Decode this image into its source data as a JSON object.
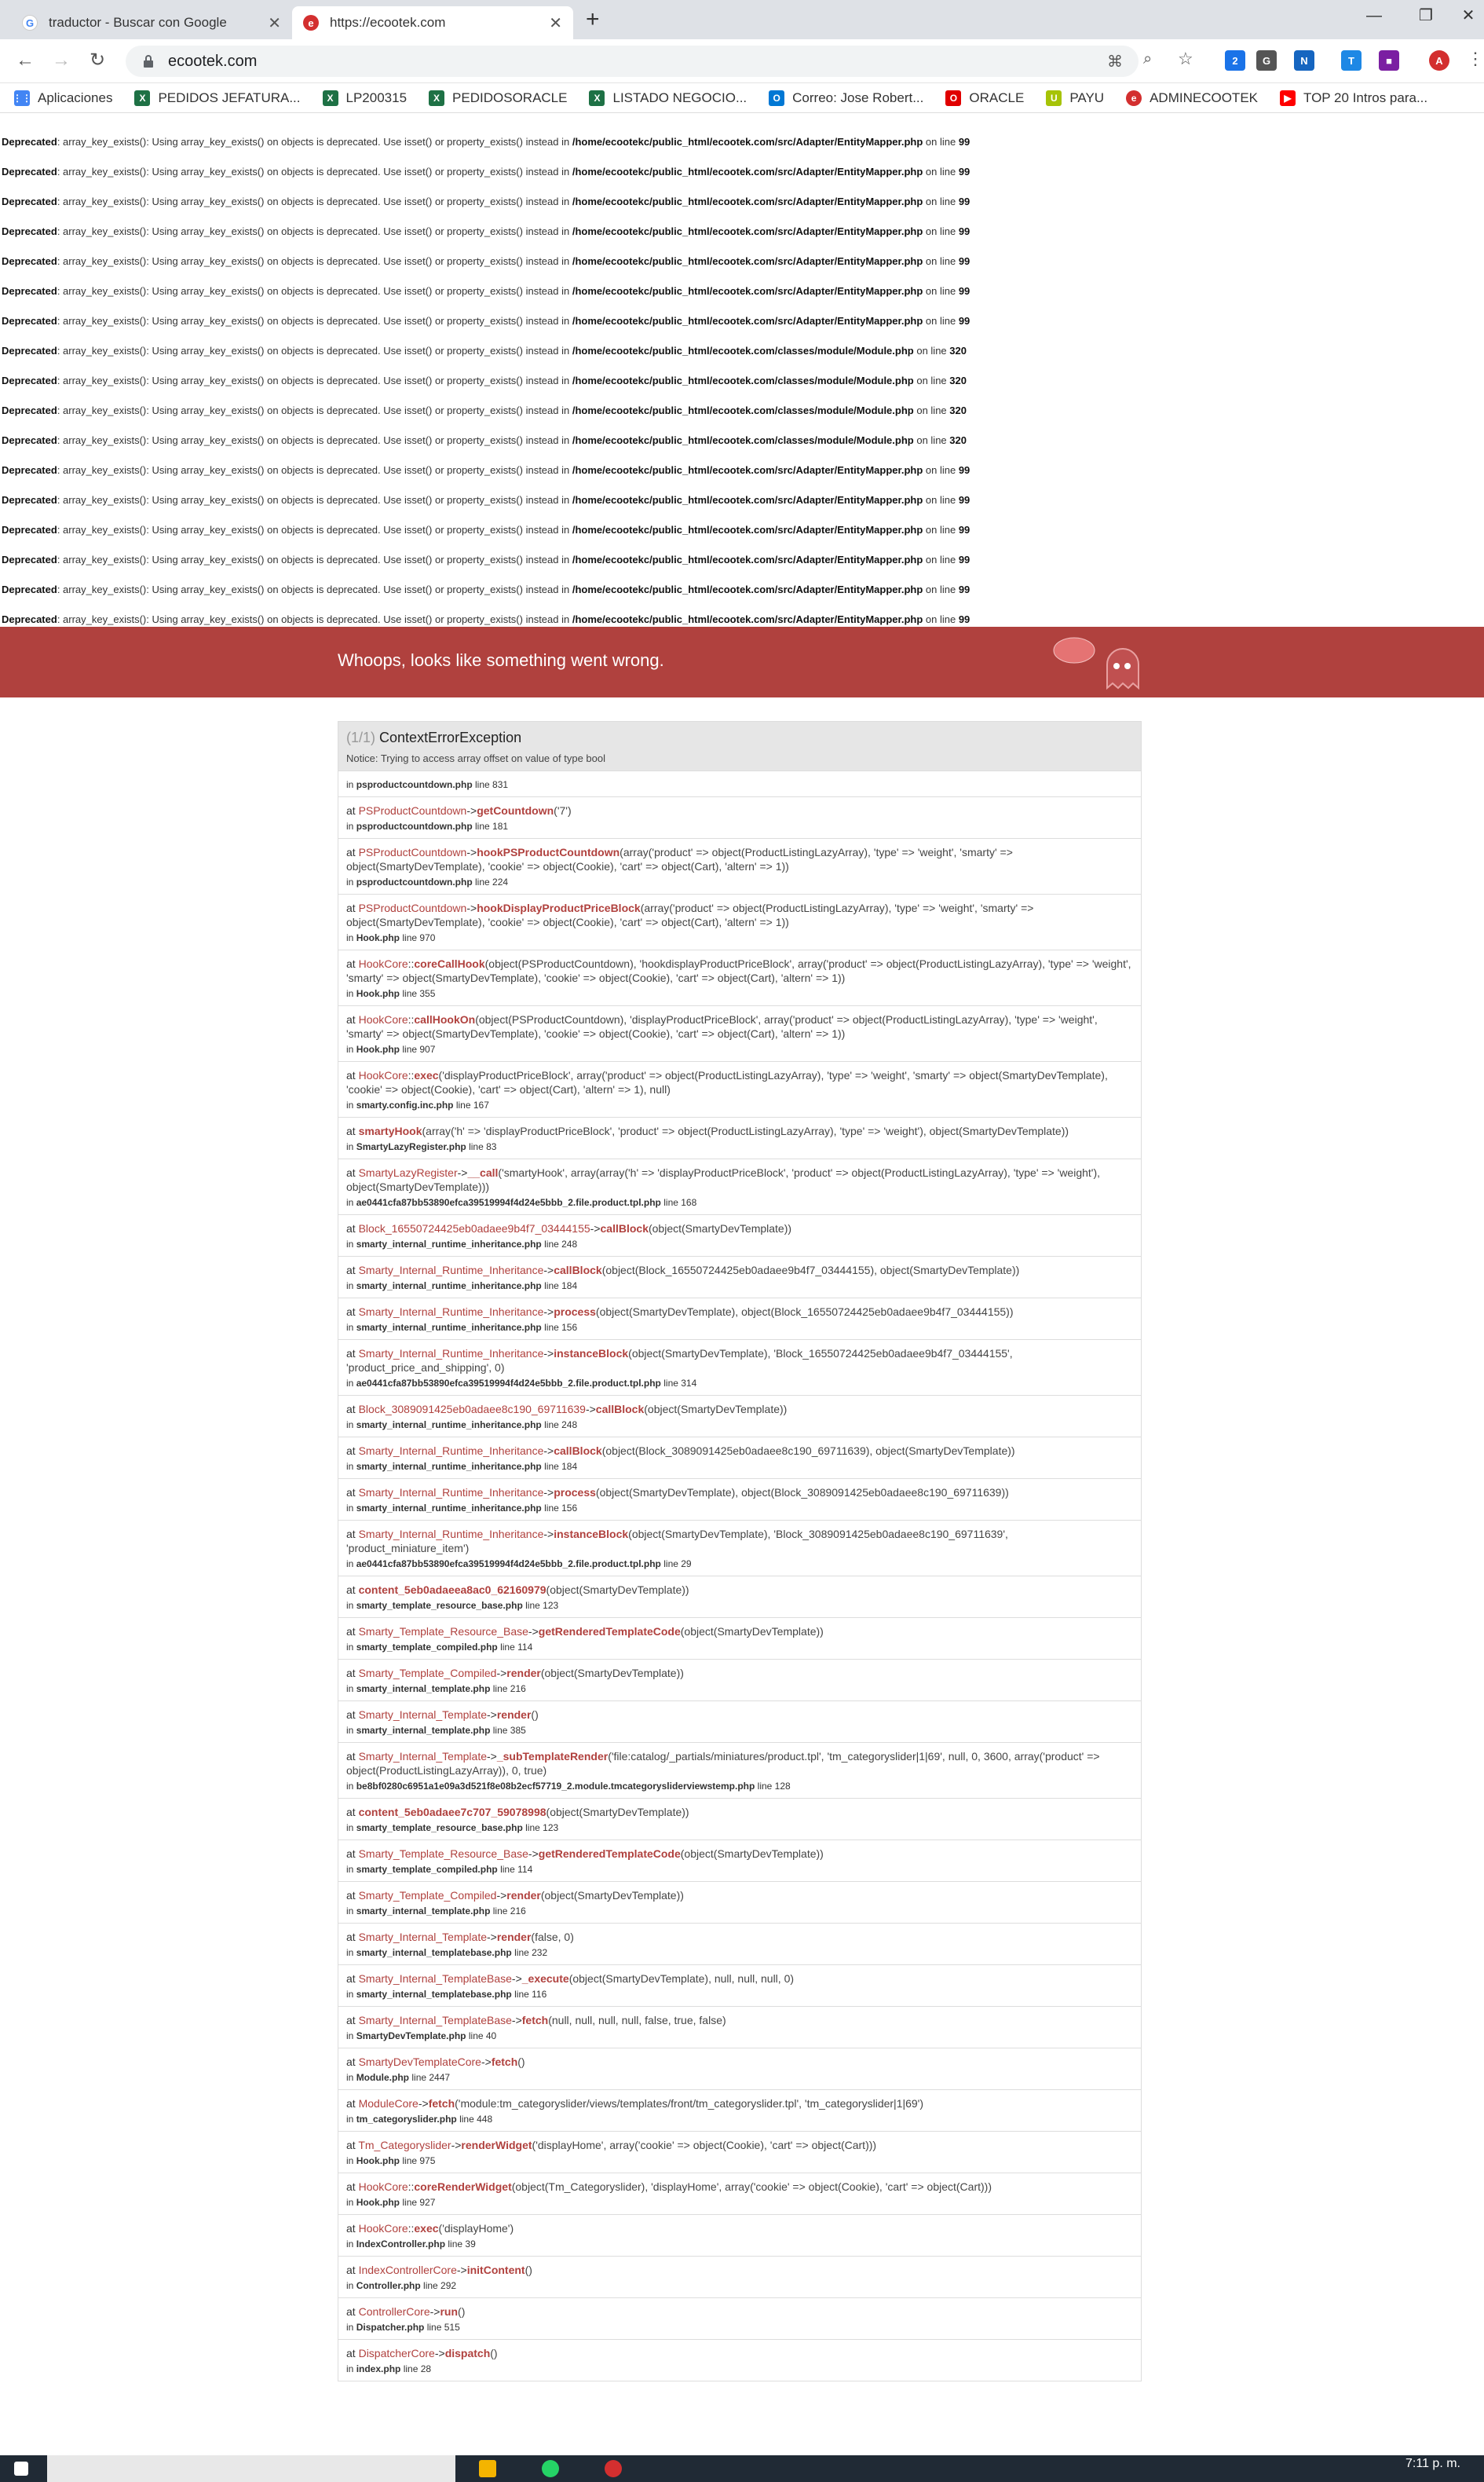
{
  "browser": {
    "tabs": [
      {
        "title": "traductor - Buscar con Google",
        "icon": "google-icon"
      },
      {
        "title": "https://ecootek.com",
        "icon": "ecootek-icon"
      }
    ],
    "new_tab_label": "+",
    "url": "ecootek.com",
    "bookmarks": [
      {
        "label": "Aplicaciones",
        "icon": "apps-grid-icon",
        "color": "#4285f4"
      },
      {
        "label": "PEDIDOS JEFATURA...",
        "icon": "excel-icon",
        "color": "#1e7145"
      },
      {
        "label": "LP200315",
        "icon": "excel-icon",
        "color": "#1e7145"
      },
      {
        "label": "PEDIDOSORACLE",
        "icon": "excel-icon",
        "color": "#1e7145"
      },
      {
        "label": "LISTADO NEGOCIO...",
        "icon": "excel-icon",
        "color": "#1e7145"
      },
      {
        "label": "Correo: Jose Robert...",
        "icon": "outlook-icon",
        "color": "#0078d4"
      },
      {
        "label": "ORACLE",
        "icon": "oracle-icon",
        "color": "#e00000"
      },
      {
        "label": "PAYU",
        "icon": "payu-icon",
        "color": "#a6c307"
      },
      {
        "label": "ADMINECOOTEK",
        "icon": "ecootek-icon",
        "color": "#d32f2f"
      },
      {
        "label": "TOP 20 Intros para...",
        "icon": "youtube-icon",
        "color": "#ff0000"
      }
    ],
    "colors": {
      "tabstrip": "#dee1e6",
      "accent": "#b0413e"
    }
  },
  "deprecated": [
    {
      "label": "Deprecated",
      "msg": ": array_key_exists(): Using array_key_exists() on objects is deprecated. Use isset() or property_exists() instead in ",
      "path": "/home/ecootekc/public_html/ecootek.com/src/Adapter/EntityMapper.php",
      "online": " on line ",
      "line": "99"
    },
    {
      "label": "Deprecated",
      "msg": ": array_key_exists(): Using array_key_exists() on objects is deprecated. Use isset() or property_exists() instead in ",
      "path": "/home/ecootekc/public_html/ecootek.com/src/Adapter/EntityMapper.php",
      "online": " on line ",
      "line": "99"
    },
    {
      "label": "Deprecated",
      "msg": ": array_key_exists(): Using array_key_exists() on objects is deprecated. Use isset() or property_exists() instead in ",
      "path": "/home/ecootekc/public_html/ecootek.com/src/Adapter/EntityMapper.php",
      "online": " on line ",
      "line": "99"
    },
    {
      "label": "Deprecated",
      "msg": ": array_key_exists(): Using array_key_exists() on objects is deprecated. Use isset() or property_exists() instead in ",
      "path": "/home/ecootekc/public_html/ecootek.com/src/Adapter/EntityMapper.php",
      "online": " on line ",
      "line": "99"
    },
    {
      "label": "Deprecated",
      "msg": ": array_key_exists(): Using array_key_exists() on objects is deprecated. Use isset() or property_exists() instead in ",
      "path": "/home/ecootekc/public_html/ecootek.com/src/Adapter/EntityMapper.php",
      "online": " on line ",
      "line": "99"
    },
    {
      "label": "Deprecated",
      "msg": ": array_key_exists(): Using array_key_exists() on objects is deprecated. Use isset() or property_exists() instead in ",
      "path": "/home/ecootekc/public_html/ecootek.com/src/Adapter/EntityMapper.php",
      "online": " on line ",
      "line": "99"
    },
    {
      "label": "Deprecated",
      "msg": ": array_key_exists(): Using array_key_exists() on objects is deprecated. Use isset() or property_exists() instead in ",
      "path": "/home/ecootekc/public_html/ecootek.com/src/Adapter/EntityMapper.php",
      "online": " on line ",
      "line": "99"
    },
    {
      "label": "Deprecated",
      "msg": ": array_key_exists(): Using array_key_exists() on objects is deprecated. Use isset() or property_exists() instead in ",
      "path": "/home/ecootekc/public_html/ecootek.com/classes/module/Module.php",
      "online": " on line ",
      "line": "320"
    },
    {
      "label": "Deprecated",
      "msg": ": array_key_exists(): Using array_key_exists() on objects is deprecated. Use isset() or property_exists() instead in ",
      "path": "/home/ecootekc/public_html/ecootek.com/classes/module/Module.php",
      "online": " on line ",
      "line": "320"
    },
    {
      "label": "Deprecated",
      "msg": ": array_key_exists(): Using array_key_exists() on objects is deprecated. Use isset() or property_exists() instead in ",
      "path": "/home/ecootekc/public_html/ecootek.com/classes/module/Module.php",
      "online": " on line ",
      "line": "320"
    },
    {
      "label": "Deprecated",
      "msg": ": array_key_exists(): Using array_key_exists() on objects is deprecated. Use isset() or property_exists() instead in ",
      "path": "/home/ecootekc/public_html/ecootek.com/classes/module/Module.php",
      "online": " on line ",
      "line": "320"
    },
    {
      "label": "Deprecated",
      "msg": ": array_key_exists(): Using array_key_exists() on objects is deprecated. Use isset() or property_exists() instead in ",
      "path": "/home/ecootekc/public_html/ecootek.com/src/Adapter/EntityMapper.php",
      "online": " on line ",
      "line": "99"
    },
    {
      "label": "Deprecated",
      "msg": ": array_key_exists(): Using array_key_exists() on objects is deprecated. Use isset() or property_exists() instead in ",
      "path": "/home/ecootekc/public_html/ecootek.com/src/Adapter/EntityMapper.php",
      "online": " on line ",
      "line": "99"
    },
    {
      "label": "Deprecated",
      "msg": ": array_key_exists(): Using array_key_exists() on objects is deprecated. Use isset() or property_exists() instead in ",
      "path": "/home/ecootekc/public_html/ecootek.com/src/Adapter/EntityMapper.php",
      "online": " on line ",
      "line": "99"
    },
    {
      "label": "Deprecated",
      "msg": ": array_key_exists(): Using array_key_exists() on objects is deprecated. Use isset() or property_exists() instead in ",
      "path": "/home/ecootekc/public_html/ecootek.com/src/Adapter/EntityMapper.php",
      "online": " on line ",
      "line": "99"
    },
    {
      "label": "Deprecated",
      "msg": ": array_key_exists(): Using array_key_exists() on objects is deprecated. Use isset() or property_exists() instead in ",
      "path": "/home/ecootekc/public_html/ecootek.com/src/Adapter/EntityMapper.php",
      "online": " on line ",
      "line": "99"
    },
    {
      "label": "Deprecated",
      "msg": ": array_key_exists(): Using array_key_exists() on objects is deprecated. Use isset() or property_exists() instead in ",
      "path": "/home/ecootekc/public_html/ecootek.com/src/Adapter/EntityMapper.php",
      "online": " on line ",
      "line": "99"
    },
    {
      "label": "Deprecated",
      "msg": ": array_key_exists(): Using array_key_exists() on objects is deprecated. Use isset() or property_exists() instead in ",
      "path": "/home/ecootekc/public_html/ecootek.com/src/Adapter/EntityMapper.php",
      "online": " on line ",
      "line": "99"
    }
  ],
  "whoops": {
    "message": "Whoops, looks like something went wrong."
  },
  "exception": {
    "count": "(1/1)",
    "name": "ContextErrorException",
    "notice": "Notice: Trying to access array offset on value of type bool",
    "first_in": "in ",
    "first_file": "psproductcountdown.php",
    "first_line": " line 831",
    "frames": [
      {
        "cls": "PSProductCountdown",
        "op": "->",
        "fn": "getCountdown",
        "args": "('7')",
        "file": "psproductcountdown.php",
        "line": "line 181"
      },
      {
        "cls": "PSProductCountdown",
        "op": "->",
        "fn": "hookPSProductCountdown",
        "args": "(array('product' => object(ProductListingLazyArray), 'type' => 'weight', 'smarty' => object(SmartyDevTemplate), 'cookie' => object(Cookie), 'cart' => object(Cart), 'altern' => 1))",
        "file": "psproductcountdown.php",
        "line": "line 224"
      },
      {
        "cls": "PSProductCountdown",
        "op": "->",
        "fn": "hookDisplayProductPriceBlock",
        "args": "(array('product' => object(ProductListingLazyArray), 'type' => 'weight', 'smarty' => object(SmartyDevTemplate), 'cookie' => object(Cookie), 'cart' => object(Cart), 'altern' => 1))",
        "file": "Hook.php",
        "line": "line 970"
      },
      {
        "cls": "HookCore",
        "op": "::",
        "fn": "coreCallHook",
        "args": "(object(PSProductCountdown), 'hookdisplayProductPriceBlock', array('product' => object(ProductListingLazyArray), 'type' => 'weight', 'smarty' => object(SmartyDevTemplate), 'cookie' => object(Cookie), 'cart' => object(Cart), 'altern' => 1))",
        "file": "Hook.php",
        "line": "line 355"
      },
      {
        "cls": "HookCore",
        "op": "::",
        "fn": "callHookOn",
        "args": "(object(PSProductCountdown), 'displayProductPriceBlock', array('product' => object(ProductListingLazyArray), 'type' => 'weight', 'smarty' => object(SmartyDevTemplate), 'cookie' => object(Cookie), 'cart' => object(Cart), 'altern' => 1))",
        "file": "Hook.php",
        "line": "line 907"
      },
      {
        "cls": "HookCore",
        "op": "::",
        "fn": "exec",
        "args": "('displayProductPriceBlock', array('product' => object(ProductListingLazyArray), 'type' => 'weight', 'smarty' => object(SmartyDevTemplate), 'cookie' => object(Cookie), 'cart' => object(Cart), 'altern' => 1), null)",
        "file": "smarty.config.inc.php",
        "line": "line 167"
      },
      {
        "cls": "",
        "op": "",
        "fn": "smartyHook",
        "args": "(array('h' => 'displayProductPriceBlock', 'product' => object(ProductListingLazyArray), 'type' => 'weight'), object(SmartyDevTemplate))",
        "file": "SmartyLazyRegister.php",
        "line": "line 83"
      },
      {
        "cls": "SmartyLazyRegister",
        "op": "->",
        "fn": "__call",
        "args": "('smartyHook', array(array('h' => 'displayProductPriceBlock', 'product' => object(ProductListingLazyArray), 'type' => 'weight'), object(SmartyDevTemplate)))",
        "file": "ae0441cfa87bb53890efca39519994f4d24e5bbb_2.file.product.tpl.php",
        "line": "line 168"
      },
      {
        "cls": "Block_16550724425eb0adaee9b4f7_03444155",
        "op": "->",
        "fn": "callBlock",
        "args": "(object(SmartyDevTemplate))",
        "file": "smarty_internal_runtime_inheritance.php",
        "line": "line 248"
      },
      {
        "cls": "Smarty_Internal_Runtime_Inheritance",
        "op": "->",
        "fn": "callBlock",
        "args": "(object(Block_16550724425eb0adaee9b4f7_03444155), object(SmartyDevTemplate))",
        "file": "smarty_internal_runtime_inheritance.php",
        "line": "line 184"
      },
      {
        "cls": "Smarty_Internal_Runtime_Inheritance",
        "op": "->",
        "fn": "process",
        "args": "(object(SmartyDevTemplate), object(Block_16550724425eb0adaee9b4f7_03444155))",
        "file": "smarty_internal_runtime_inheritance.php",
        "line": "line 156"
      },
      {
        "cls": "Smarty_Internal_Runtime_Inheritance",
        "op": "->",
        "fn": "instanceBlock",
        "args": "(object(SmartyDevTemplate), 'Block_16550724425eb0adaee9b4f7_03444155', 'product_price_and_shipping', 0)",
        "file": "ae0441cfa87bb53890efca39519994f4d24e5bbb_2.file.product.tpl.php",
        "line": "line 314"
      },
      {
        "cls": "Block_3089091425eb0adaee8c190_69711639",
        "op": "->",
        "fn": "callBlock",
        "args": "(object(SmartyDevTemplate))",
        "file": "smarty_internal_runtime_inheritance.php",
        "line": "line 248"
      },
      {
        "cls": "Smarty_Internal_Runtime_Inheritance",
        "op": "->",
        "fn": "callBlock",
        "args": "(object(Block_3089091425eb0adaee8c190_69711639), object(SmartyDevTemplate))",
        "file": "smarty_internal_runtime_inheritance.php",
        "line": "line 184"
      },
      {
        "cls": "Smarty_Internal_Runtime_Inheritance",
        "op": "->",
        "fn": "process",
        "args": "(object(SmartyDevTemplate), object(Block_3089091425eb0adaee8c190_69711639))",
        "file": "smarty_internal_runtime_inheritance.php",
        "line": "line 156"
      },
      {
        "cls": "Smarty_Internal_Runtime_Inheritance",
        "op": "->",
        "fn": "instanceBlock",
        "args": "(object(SmartyDevTemplate), 'Block_3089091425eb0adaee8c190_69711639', 'product_miniature_item')",
        "file": "ae0441cfa87bb53890efca39519994f4d24e5bbb_2.file.product.tpl.php",
        "line": "line 29"
      },
      {
        "cls": "",
        "op": "",
        "fn": "content_5eb0adaeea8ac0_62160979",
        "args": "(object(SmartyDevTemplate))",
        "file": "smarty_template_resource_base.php",
        "line": "line 123"
      },
      {
        "cls": "Smarty_Template_Resource_Base",
        "op": "->",
        "fn": "getRenderedTemplateCode",
        "args": "(object(SmartyDevTemplate))",
        "file": "smarty_template_compiled.php",
        "line": "line 114"
      },
      {
        "cls": "Smarty_Template_Compiled",
        "op": "->",
        "fn": "render",
        "args": "(object(SmartyDevTemplate))",
        "file": "smarty_internal_template.php",
        "line": "line 216"
      },
      {
        "cls": "Smarty_Internal_Template",
        "op": "->",
        "fn": "render",
        "args": "()",
        "file": "smarty_internal_template.php",
        "line": "line 385"
      },
      {
        "cls": "Smarty_Internal_Template",
        "op": "->",
        "fn": "_subTemplateRender",
        "args": "('file:catalog/_partials/miniatures/product.tpl', 'tm_categoryslider|1|69', null, 0, 3600, array('product' => object(ProductListingLazyArray)), 0, true)",
        "file": "be8bf0280c6951a1e09a3d521f8e08b2ecf57719_2.module.tmcategorysliderviewstemp.php",
        "line": "line 128"
      },
      {
        "cls": "",
        "op": "",
        "fn": "content_5eb0adaee7c707_59078998",
        "args": "(object(SmartyDevTemplate))",
        "file": "smarty_template_resource_base.php",
        "line": "line 123"
      },
      {
        "cls": "Smarty_Template_Resource_Base",
        "op": "->",
        "fn": "getRenderedTemplateCode",
        "args": "(object(SmartyDevTemplate))",
        "file": "smarty_template_compiled.php",
        "line": "line 114"
      },
      {
        "cls": "Smarty_Template_Compiled",
        "op": "->",
        "fn": "render",
        "args": "(object(SmartyDevTemplate))",
        "file": "smarty_internal_template.php",
        "line": "line 216"
      },
      {
        "cls": "Smarty_Internal_Template",
        "op": "->",
        "fn": "render",
        "args": "(false, 0)",
        "file": "smarty_internal_templatebase.php",
        "line": "line 232"
      },
      {
        "cls": "Smarty_Internal_TemplateBase",
        "op": "->",
        "fn": "_execute",
        "args": "(object(SmartyDevTemplate), null, null, null, 0)",
        "file": "smarty_internal_templatebase.php",
        "line": "line 116"
      },
      {
        "cls": "Smarty_Internal_TemplateBase",
        "op": "->",
        "fn": "fetch",
        "args": "(null, null, null, null, false, true, false)",
        "file": "SmartyDevTemplate.php",
        "line": "line 40"
      },
      {
        "cls": "SmartyDevTemplateCore",
        "op": "->",
        "fn": "fetch",
        "args": "()",
        "file": "Module.php",
        "line": "line 2447"
      },
      {
        "cls": "ModuleCore",
        "op": "->",
        "fn": "fetch",
        "args": "('module:tm_categoryslider/views/templates/front/tm_categoryslider.tpl', 'tm_categoryslider|1|69')",
        "file": "tm_categoryslider.php",
        "line": "line 448"
      },
      {
        "cls": "Tm_Categoryslider",
        "op": "->",
        "fn": "renderWidget",
        "args": "('displayHome', array('cookie' => object(Cookie), 'cart' => object(Cart)))",
        "file": "Hook.php",
        "line": "line 975"
      },
      {
        "cls": "HookCore",
        "op": "::",
        "fn": "coreRenderWidget",
        "args": "(object(Tm_Categoryslider), 'displayHome', array('cookie' => object(Cookie), 'cart' => object(Cart)))",
        "file": "Hook.php",
        "line": "line 927"
      },
      {
        "cls": "HookCore",
        "op": "::",
        "fn": "exec",
        "args": "('displayHome')",
        "file": "IndexController.php",
        "line": "line 39"
      },
      {
        "cls": "IndexControllerCore",
        "op": "->",
        "fn": "initContent",
        "args": "()",
        "file": "Controller.php",
        "line": "line 292"
      },
      {
        "cls": "ControllerCore",
        "op": "->",
        "fn": "run",
        "args": "()",
        "file": "Dispatcher.php",
        "line": "line 515"
      },
      {
        "cls": "DispatcherCore",
        "op": "->",
        "fn": "dispatch",
        "args": "()",
        "file": "index.php",
        "line": "line 28"
      }
    ]
  },
  "taskbar": {
    "time": "7:11 p. m."
  }
}
